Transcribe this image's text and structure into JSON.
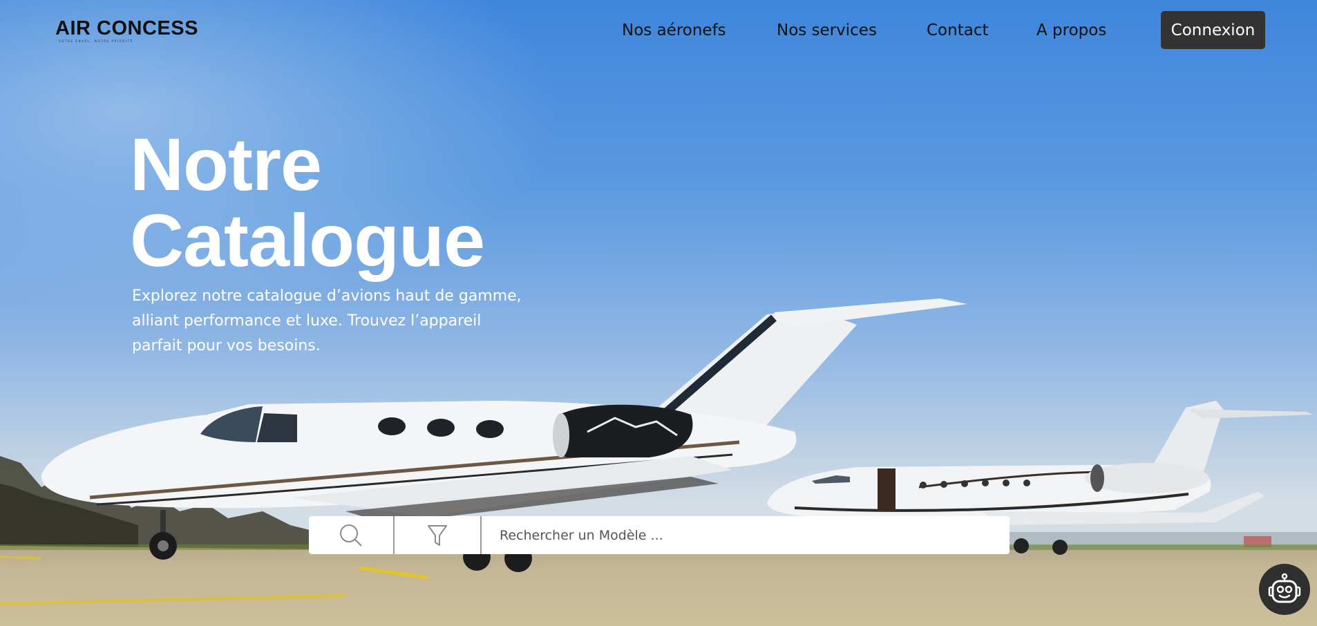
{
  "brand": {
    "name": "AIR CONCESS",
    "tagline": "VOTRE ENVOL, NOTRE PRIORITÉ"
  },
  "nav": {
    "items": [
      "Nos aéronefs",
      "Nos services",
      "Contact",
      "A propos"
    ],
    "login_label": "Connexion"
  },
  "hero": {
    "title": "Notre\nCatalogue",
    "description": "Explorez notre catalogue d’avions haut de gamme, alliant performance et luxe. Trouvez l’appareil parfait pour vos besoins."
  },
  "search": {
    "placeholder": "Rechercher un Modèle ...",
    "value": "",
    "icons": [
      "search-icon",
      "filter-icon"
    ]
  },
  "chatbot": {
    "icon": "robot-icon"
  },
  "colors": {
    "button_bg": "#333333",
    "hero_text": "#ffffff",
    "sky": "#3e86dc"
  }
}
